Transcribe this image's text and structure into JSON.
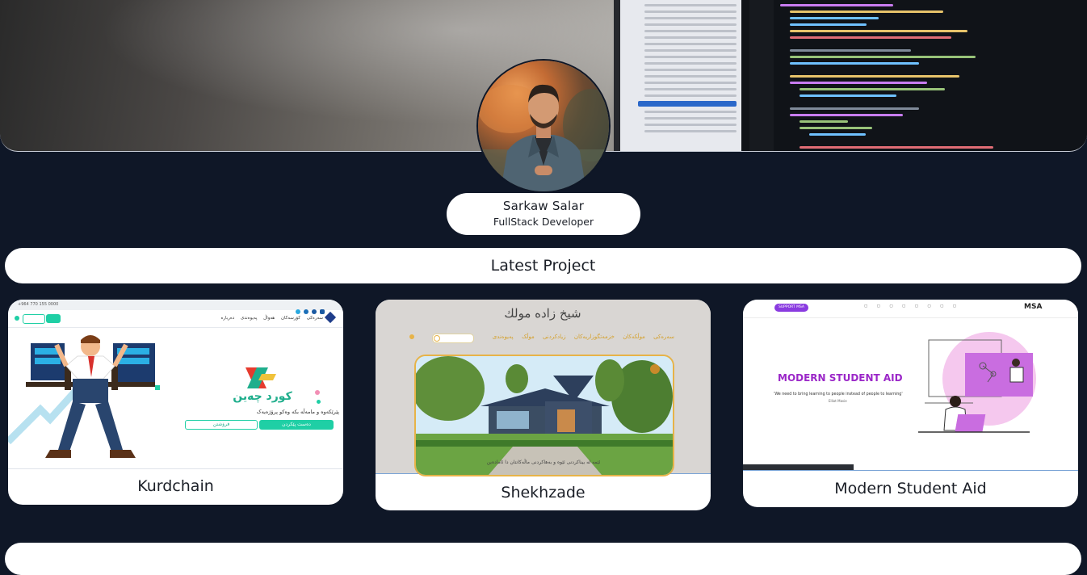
{
  "profile": {
    "name": "Sarkaw Salar",
    "role": "FullStack Developer"
  },
  "sections": {
    "latest_project_title": "Latest Project"
  },
  "projects": [
    {
      "title": "Kurdchain",
      "thumb": {
        "phone": "+964 770 155 0000",
        "brand": "کورد چەین",
        "tagline": "پێرێکەوە و مامەڵە بکە وەکو پرۆژەیەک",
        "primary_button": "دەست پێکردن",
        "secondary_button": "فرۆشتن",
        "nav_items": [
          "سەرەکی",
          "کۆرسەکان",
          "هەواڵ",
          "پەیوەندی",
          "دەربارە"
        ],
        "accent_color": "#1fcfa5"
      }
    },
    {
      "title": "Shekhzade",
      "thumb": {
        "logo": "شيخ زاده مولك",
        "nav_items": [
          "سەرەکی",
          "موڵکەکان",
          "خزمەتگوزاریەکان",
          "زیادکردنی موڵک",
          "پەیوەندی"
        ],
        "banner": "ئێمە لە بیناکردنی ئێوە و بەهاکردنی ماڵەکانتان دا ئامادەین",
        "accent_color": "#e7b348"
      }
    },
    {
      "title": "Modern Student Aid",
      "thumb": {
        "headline": "MODERN STUDENT AID",
        "quote": "'We need to bring learning to people instead of people to learning'",
        "quote_author": "Elliot Masie",
        "logo": "MSA",
        "cta": "SUPPORT MSA",
        "accent_color": "#b02bd6"
      }
    }
  ]
}
